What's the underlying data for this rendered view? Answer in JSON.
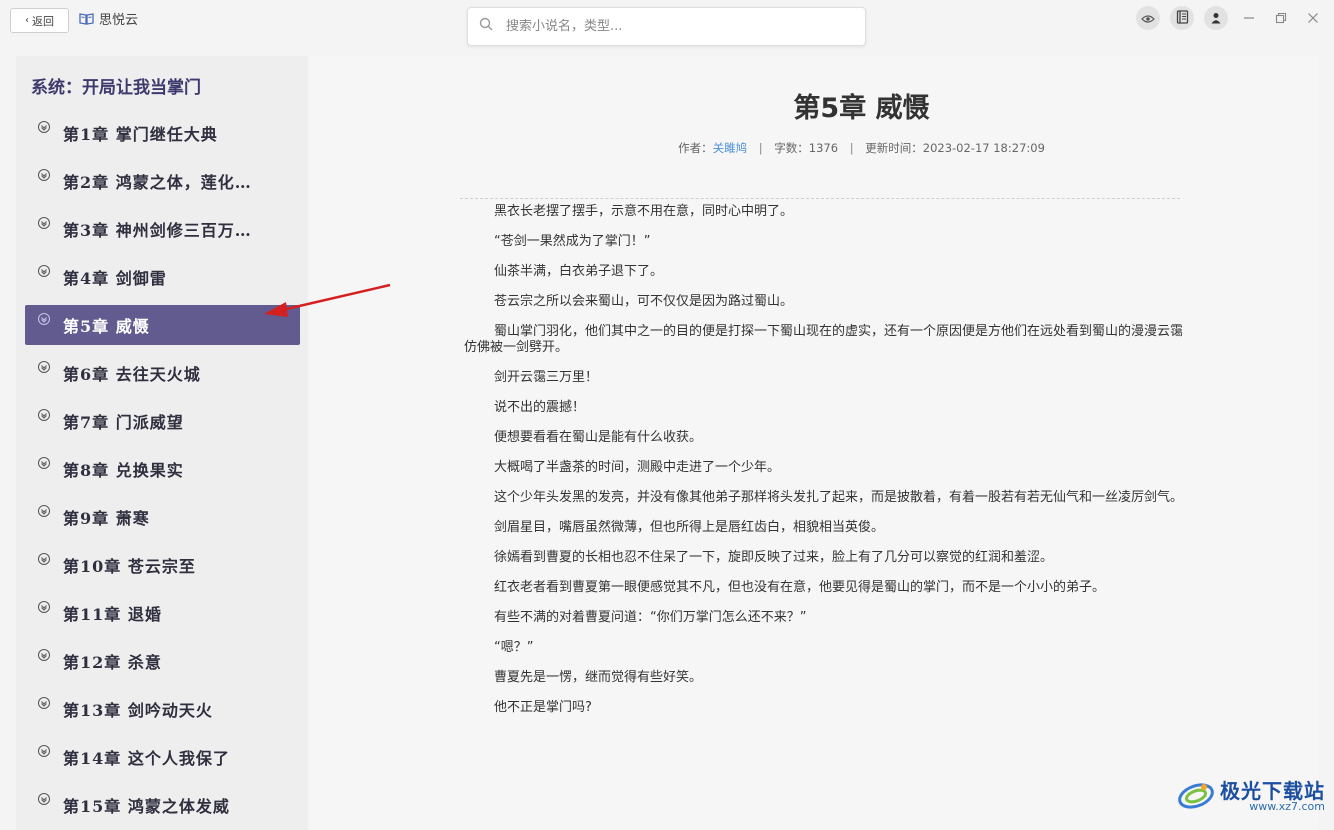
{
  "app": {
    "back_label": "返回",
    "name": "思悦云",
    "search_placeholder": "搜索小说名，类型..."
  },
  "icons": {
    "back": "chevron-left-icon",
    "app": "open-book-icon",
    "search": "search-icon",
    "eye": "eye-icon",
    "bookshelf": "books-icon",
    "user": "user-icon",
    "minimize": "minimize-icon",
    "restore": "restore-icon",
    "close": "close-icon",
    "chapter": "chevron-circle-down-icon"
  },
  "book": {
    "title": "系统：开局让我当掌门"
  },
  "chapters": [
    {
      "label": "第1章  掌门继任大典"
    },
    {
      "label": "第2章  鸿蒙之体，莲化…"
    },
    {
      "label": "第3章  神州剑修三百万…"
    },
    {
      "label": "第4章  剑御雷"
    },
    {
      "label": "第5章  威慑"
    },
    {
      "label": "第6章  去往天火城"
    },
    {
      "label": "第7章  门派威望"
    },
    {
      "label": "第8章  兑换果实"
    },
    {
      "label": "第9章  萧寒"
    },
    {
      "label": "第10章  苍云宗至"
    },
    {
      "label": "第11章  退婚"
    },
    {
      "label": "第12章  杀意"
    },
    {
      "label": "第13章  剑吟动天火"
    },
    {
      "label": "第14章  这个人我保了"
    },
    {
      "label": "第15章  鸿蒙之体发威"
    }
  ],
  "active_chapter_index": 4,
  "chapter": {
    "title": "第5章 威慑",
    "author_label": "作者：",
    "author": "关雎鸠",
    "words_label": "字数：",
    "words": "1376",
    "updated_label": "更新时间：",
    "updated": "2023-02-17 18:27:09",
    "separator": "|"
  },
  "paragraphs": [
    "黑衣长老摆了摆手，示意不用在意，同时心中明了。",
    "“苍剑一果然成为了掌门！”",
    "仙茶半满，白衣弟子退下了。",
    "苍云宗之所以会来蜀山，可不仅仅是因为路过蜀山。",
    "蜀山掌门羽化，他们其中之一的目的便是打探一下蜀山现在的虚实，还有一个原因便是方他们在远处看到蜀山的漫漫云霭仿佛被一剑劈开。",
    "剑开云霭三万里！",
    "说不出的震撼！",
    "便想要看看在蜀山是能有什么收获。",
    "大概喝了半盏茶的时间，测殿中走进了一个少年。",
    "这个少年头发黑的发亮，并没有像其他弟子那样将头发扎了起来，而是披散着，有着一股若有若无仙气和一丝凌厉剑气。",
    "剑眉星目，嘴唇虽然微薄，但也所得上是唇红齿白，相貌相当英俊。",
    "徐嫣看到曹夏的长相也忍不住呆了一下，旋即反映了过来，脸上有了几分可以察觉的红润和羞涩。",
    "红衣老者看到曹夏第一眼便感觉其不凡，但也没有在意，他要见得是蜀山的掌门，而不是一个小小的弟子。",
    "有些不满的对着曹夏问道：“你们万掌门怎么还不来？”",
    "“嗯？”",
    "曹夏先是一愣，继而觉得有些好笑。",
    "他不正是掌门吗?"
  ],
  "watermark": {
    "name": "极光下载站",
    "url": "www.xz7.com"
  },
  "colors": {
    "active_chapter_bg": "#625b8f",
    "book_title": "#3d3a6e",
    "author_link": "#4a90d9",
    "arrow": "#d42020"
  }
}
